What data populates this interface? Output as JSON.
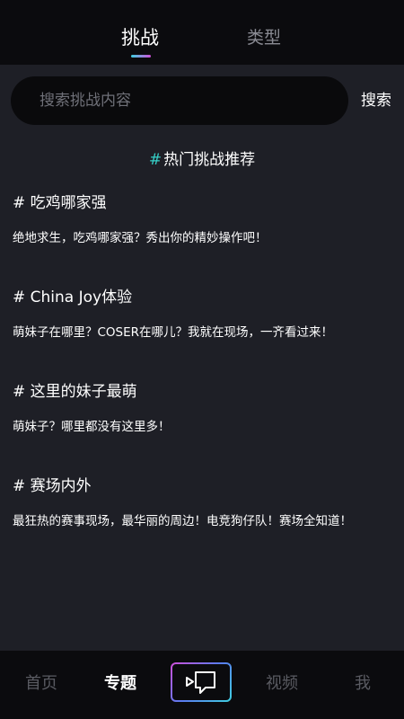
{
  "top_tabs": {
    "challenge": "挑战",
    "type": "类型",
    "active": "challenge"
  },
  "search": {
    "placeholder": "搜索挑战内容",
    "value": "",
    "button_label": "搜索"
  },
  "section": {
    "hash": "#",
    "title": "热门挑战推荐"
  },
  "challenges": [
    {
      "title": "# 吃鸡哪家强",
      "desc": "绝地求生，吃鸡哪家强？秀出你的精妙操作吧！"
    },
    {
      "title": "# China Joy体验",
      "desc": "萌妹子在哪里？COSER在哪儿？我就在现场，一齐看过来！"
    },
    {
      "title": "# 这里的妹子最萌",
      "desc": "萌妹子？哪里都没有这里多！"
    },
    {
      "title": "# 赛场内外",
      "desc": "最狂热的赛事现场，最华丽的周边！电竞狗仔队！赛场全知道！"
    }
  ],
  "bottom_nav": {
    "home": "首页",
    "topic": "专题",
    "record_icon": "video-camera-icon",
    "video": "视频",
    "me": "我",
    "active": "topic"
  },
  "colors": {
    "background": "#1e1f26",
    "bar_background": "#0b0b0e",
    "accent_cyan": "#36d0c8",
    "accent_magenta": "#d04fd8",
    "inactive_text": "#5a5b62"
  }
}
